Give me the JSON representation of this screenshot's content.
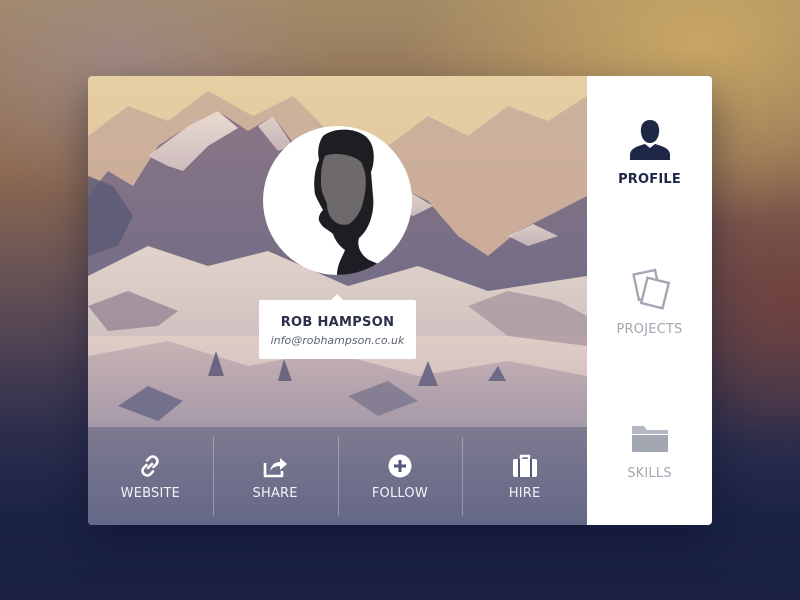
{
  "profile": {
    "name": "ROB HAMPSON",
    "email": "info@robhampson.co.uk"
  },
  "actions": [
    {
      "label": "WEBSITE",
      "icon": "link-icon"
    },
    {
      "label": "SHARE",
      "icon": "share-icon"
    },
    {
      "label": "FOLLOW",
      "icon": "plus-circle-icon"
    },
    {
      "label": "HIRE",
      "icon": "briefcase-icon"
    }
  ],
  "sidebar": {
    "items": [
      {
        "label": "PROFILE",
        "icon": "user-icon",
        "active": true
      },
      {
        "label": "PROJECTS",
        "icon": "cards-icon",
        "active": false
      },
      {
        "label": "SKILLS",
        "icon": "folder-icon",
        "active": false
      }
    ]
  },
  "colors": {
    "nav_active": "#1f2746",
    "nav_inactive": "#a2a7b2",
    "card_text": "#2a3048"
  }
}
